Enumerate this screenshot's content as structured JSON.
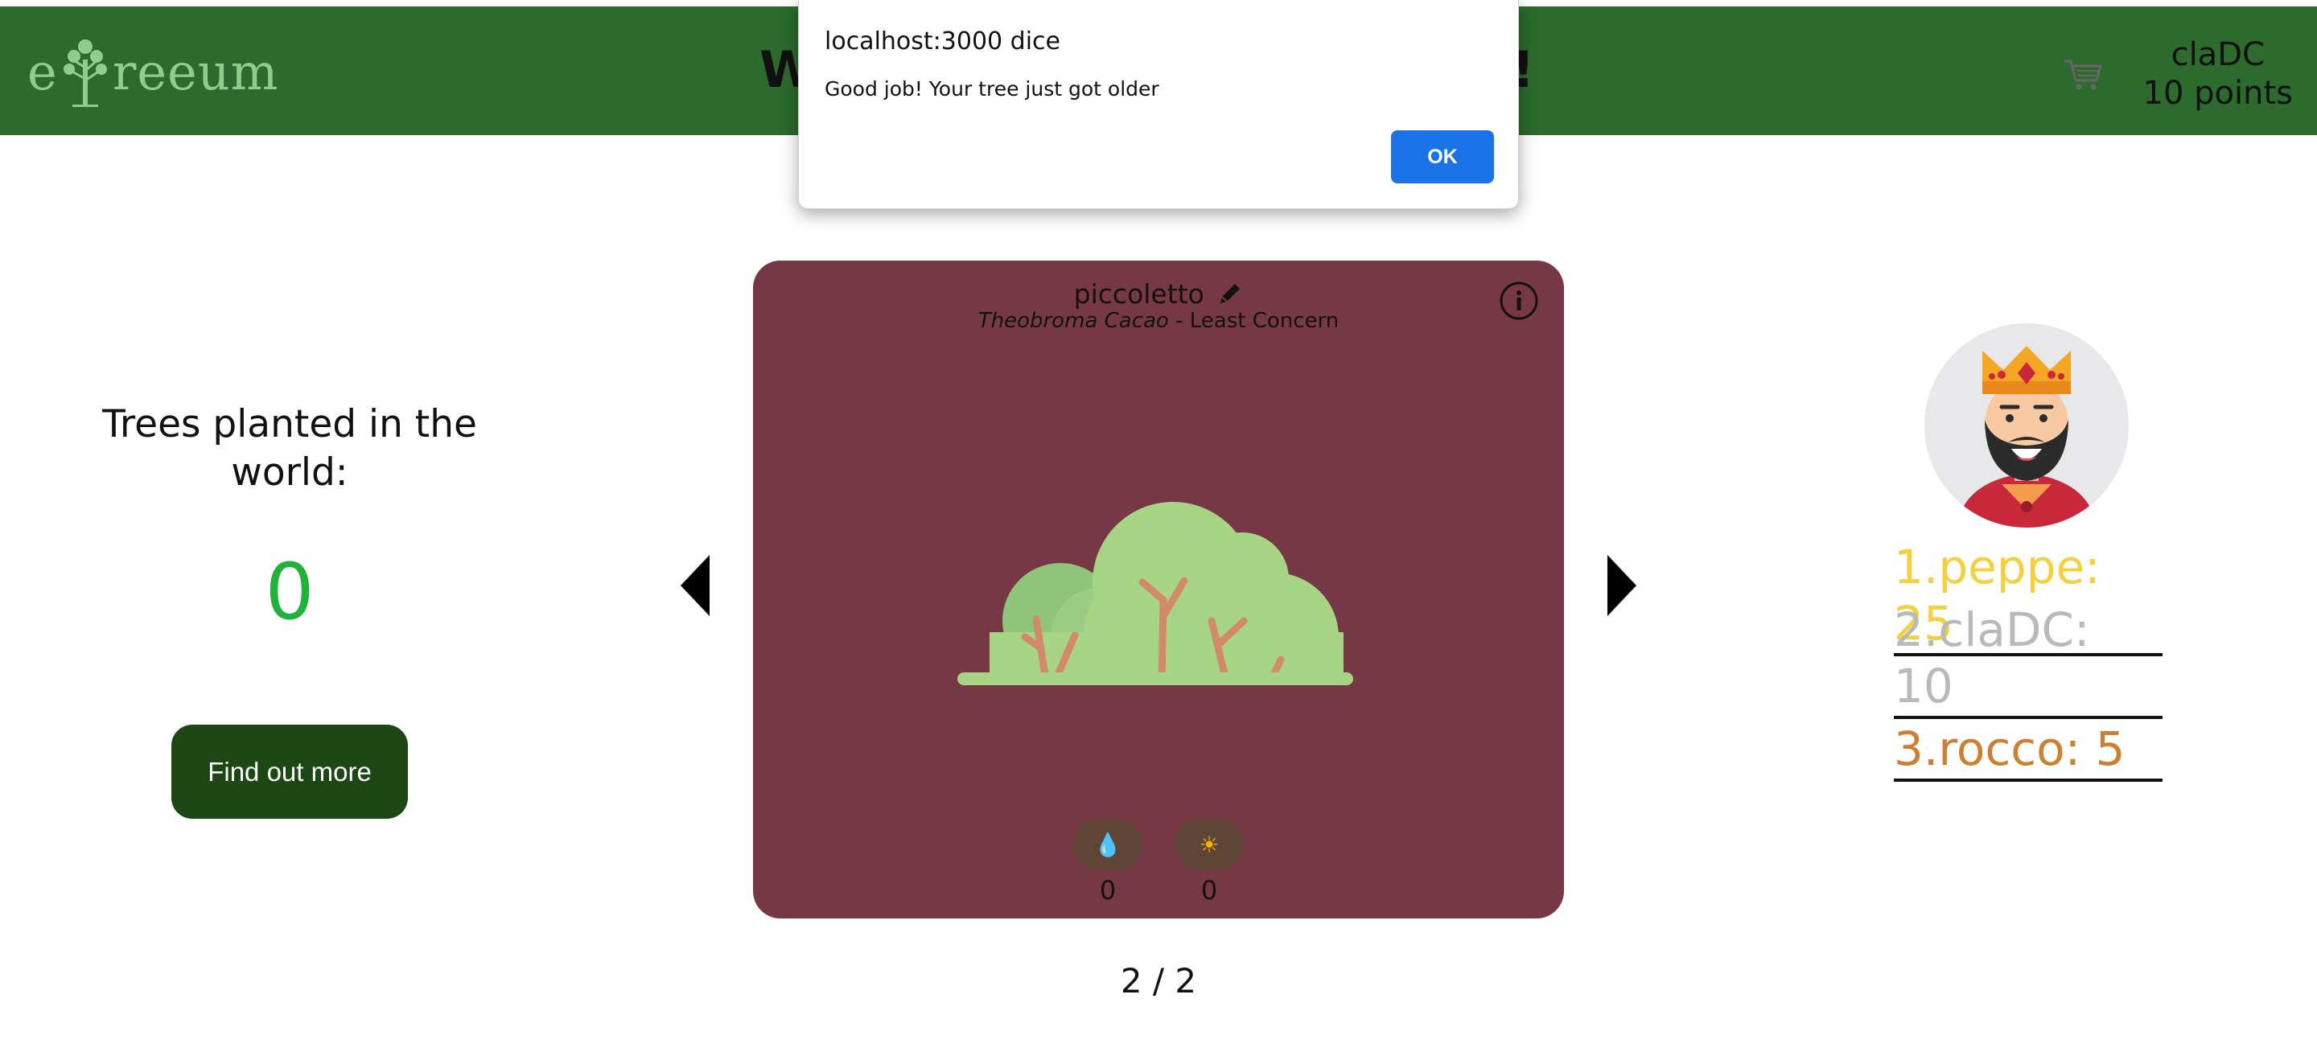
{
  "header": {
    "logo_left": "e",
    "logo_right": "reeum",
    "welcome_start": "W",
    "welcome_end": "n!",
    "username": "claDC",
    "points": "10 points"
  },
  "stats": {
    "title": "Trees planted in the world:",
    "count": "0",
    "button_label": "Find out more"
  },
  "tree_card": {
    "name": "piccoletto",
    "scientific_name": "Theobroma Cacao",
    "separator": " - ",
    "status": "Least Concern",
    "water_icon": "💧",
    "water_value": "0",
    "sun_icon": "☀",
    "sun_value": "0"
  },
  "pager": "2 / 2",
  "leaderboard": [
    {
      "label": "1.peppe: 25",
      "color": "#f4d03f"
    },
    {
      "label": "2.claDC: 10",
      "color": "#b9b9b9"
    },
    {
      "label": "3.rocco: 5",
      "color": "#cd7f32"
    }
  ],
  "alert": {
    "title": "localhost:3000 dice",
    "message": "Good job! Your tree just got older",
    "ok_label": "OK"
  },
  "colors": {
    "header_bg": "#2c6a2d",
    "card_bg": "#763845",
    "count_green": "#21b23a",
    "button_bg": "#1d4715",
    "alert_ok": "#1a73e8"
  }
}
